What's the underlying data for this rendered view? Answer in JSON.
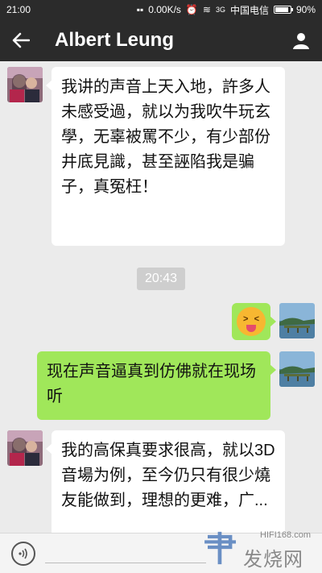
{
  "status_bar": {
    "time": "21:00",
    "speed": "0.00K/s",
    "network": "3G",
    "carrier": "中国电信",
    "battery": "90%",
    "battery_level": 0.9
  },
  "header": {
    "title": "Albert Leung",
    "back_icon": "arrow-left-icon",
    "profile_icon": "person-icon"
  },
  "messages": [
    {
      "direction": "in",
      "text": "我讲的声音上天入地，許多人未感受過，就以为我吹牛玩玄學，无辜被罵不少，有少部份井底見識，甚至誣陷我是骗子，真冤枉！"
    },
    {
      "type": "timestamp",
      "text": "20:43"
    },
    {
      "direction": "out",
      "emoji": "squinting-tongue-face"
    },
    {
      "direction": "out",
      "text": "现在声音逼真到仿佛就在现场听"
    },
    {
      "direction": "in",
      "text": "我的高保真要求很高，就以3D音場为例，至今仍只有很少燒友能做到，理想的更难，广..."
    }
  ],
  "bottom_bar": {
    "voice_icon": "voice-icon"
  },
  "watermark": {
    "url": "HIFI168.com",
    "text": "发烧网"
  }
}
